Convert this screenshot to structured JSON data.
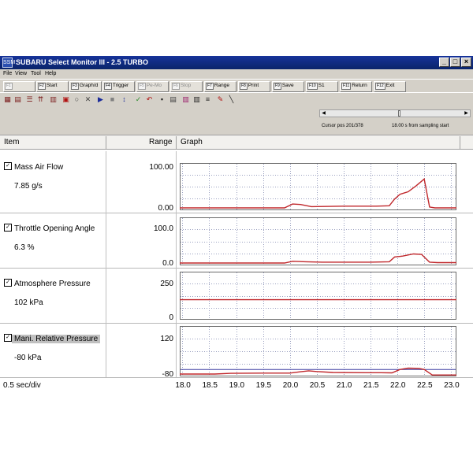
{
  "window": {
    "title": "SUBARU Select Monitor III - 2.5 TURBO",
    "app_icon": "SSM",
    "buttons": {
      "minimize": "_",
      "maximize": "□",
      "close": "×"
    }
  },
  "menu": [
    "File",
    "View",
    "Tool",
    "Help"
  ],
  "fkeys": [
    {
      "key": "F1",
      "label": "",
      "enabled": false
    },
    {
      "key": "F2",
      "label": "Start",
      "enabled": true
    },
    {
      "key": "F3",
      "label": "Graph/d",
      "enabled": true
    },
    {
      "key": "F4",
      "label": "Trigger",
      "enabled": true
    },
    {
      "key": "F5",
      "label": "Pe-Mo",
      "enabled": false
    },
    {
      "key": "F6",
      "label": "Stop",
      "enabled": false
    },
    {
      "key": "F7",
      "label": "Range",
      "enabled": true
    },
    {
      "key": "F8",
      "label": "Print",
      "enabled": true
    },
    {
      "key": "F9",
      "label": "Save",
      "enabled": true
    },
    {
      "key": "F10",
      "label": "S1",
      "enabled": true
    },
    {
      "key": "F11",
      "label": "Return",
      "enabled": true
    },
    {
      "key": "F12",
      "label": "Exit",
      "enabled": true
    }
  ],
  "toolbar_icons": [
    {
      "name": "grid-view-icon",
      "glyph": "▦",
      "color": "#7a1a1a"
    },
    {
      "name": "table-view-icon",
      "glyph": "▤",
      "color": "#7a1a1a"
    },
    {
      "name": "list-view-icon",
      "glyph": "☰",
      "color": "#7a1a1a"
    },
    {
      "name": "bar-view-icon",
      "glyph": "⇈",
      "color": "#7a1a1a"
    },
    {
      "name": "column-view-icon",
      "glyph": "▥",
      "color": "#7a1a1a"
    },
    {
      "name": "record-icon",
      "glyph": "▣",
      "color": "#b01010"
    },
    {
      "name": "stop-record-icon",
      "glyph": "○",
      "color": "#404040"
    },
    {
      "name": "clear-icon",
      "glyph": "✕",
      "color": "#404040"
    },
    {
      "name": "play-icon",
      "glyph": "▶",
      "color": "#1a2a9a"
    },
    {
      "name": "stop-icon",
      "glyph": "■",
      "color": "#808080"
    },
    {
      "name": "scroll-icon",
      "glyph": "↕",
      "color": "#1a2a9a"
    },
    {
      "name": "check-icon",
      "glyph": "✓",
      "color": "#2a8a2a"
    },
    {
      "name": "undo-icon",
      "glyph": "↶",
      "color": "#b01010"
    },
    {
      "name": "save-icon",
      "glyph": "▪",
      "color": "#202020"
    },
    {
      "name": "print-icon",
      "glyph": "▤",
      "color": "#404040"
    },
    {
      "name": "bars-color-icon",
      "glyph": "▥",
      "color": "#9a1a6a"
    },
    {
      "name": "bars-icon",
      "glyph": "▥",
      "color": "#202020"
    },
    {
      "name": "lines-icon",
      "glyph": "≡",
      "color": "#202020"
    },
    {
      "name": "pen-icon",
      "glyph": "✎",
      "color": "#b01010"
    },
    {
      "name": "line-tool-icon",
      "glyph": "╲",
      "color": "#202020"
    }
  ],
  "status": {
    "cursor_pos": "Cursor pos   201/378",
    "sampling": "18.00 s from sampling start",
    "scroll_position": 0.53
  },
  "table": {
    "col_item": "Item",
    "col_range": "Range",
    "col_graph": "Graph",
    "footer_scale": "0.5 sec/div"
  },
  "signals": [
    {
      "name": "Mass Air Flow",
      "value": "7.85 g/s",
      "max": "100.00",
      "min": "0.00",
      "checked": true,
      "selected": false
    },
    {
      "name": "Throttle Opening Angle",
      "value": "6.3 %",
      "max": "100.0",
      "min": "0.0",
      "checked": true,
      "selected": false
    },
    {
      "name": "Atmosphere Pressure",
      "value": "102 kPa",
      "max": "250",
      "min": "0",
      "checked": true,
      "selected": false
    },
    {
      "name": "Mani. Relative Pressure",
      "value": "-80 kPa",
      "max": "120",
      "min": "-80",
      "checked": true,
      "selected": true
    }
  ],
  "chart_data": {
    "type": "line",
    "x_ticks": [
      "18.0",
      "18.5",
      "19.0",
      "19.5",
      "20.0",
      "20.5",
      "21.0",
      "21.5",
      "22.0",
      "22.5",
      "23.0"
    ],
    "xlim": [
      17.95,
      23.1
    ],
    "line_color": "#c0282c",
    "grid_color": "#9aa0c0",
    "series": [
      {
        "name": "Mass Air Flow",
        "ylim": [
          0,
          100
        ],
        "x": [
          17.95,
          19.9,
          20.05,
          20.2,
          20.4,
          21.0,
          21.6,
          21.85,
          21.95,
          22.05,
          22.2,
          22.35,
          22.5,
          22.6,
          22.7,
          22.8,
          23.1
        ],
        "y": [
          0,
          0,
          9,
          8,
          3,
          4,
          4,
          5,
          21,
          32,
          38,
          52,
          68,
          2,
          0,
          0,
          0
        ]
      },
      {
        "name": "Throttle Opening Angle",
        "ylim": [
          0,
          100
        ],
        "x": [
          17.95,
          19.9,
          20.05,
          20.3,
          20.6,
          21.0,
          21.5,
          21.85,
          21.95,
          22.1,
          22.3,
          22.45,
          22.6,
          22.75,
          23.1
        ],
        "y": [
          0,
          0,
          4,
          3,
          2,
          2,
          2,
          3,
          14,
          16,
          21,
          20,
          2,
          1,
          1
        ]
      },
      {
        "name": "Atmosphere Pressure",
        "ylim": [
          0,
          250
        ],
        "x": [
          17.95,
          23.1
        ],
        "y": [
          102,
          102
        ]
      },
      {
        "name": "Mani. Relative Pressure",
        "ylim": [
          -80,
          120
        ],
        "x": [
          17.95,
          18.6,
          18.9,
          19.5,
          20.0,
          20.2,
          20.35,
          20.5,
          20.8,
          21.4,
          21.7,
          21.9,
          22.05,
          22.2,
          22.4,
          22.5,
          22.65,
          23.1
        ],
        "y": [
          -80,
          -80,
          -77,
          -76,
          -76,
          -70,
          -66,
          -69,
          -73,
          -74,
          -74,
          -75,
          -60,
          -54,
          -55,
          -60,
          -84,
          -84
        ]
      }
    ],
    "ref_lines": [
      null,
      null,
      null,
      {
        "y": -60,
        "color": "#3a3aa0"
      }
    ]
  }
}
